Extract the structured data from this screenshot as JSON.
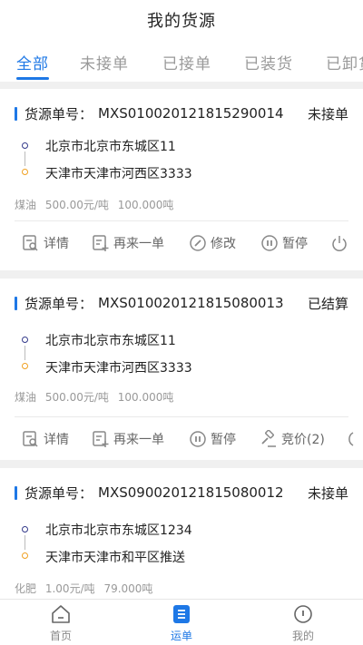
{
  "header": {
    "title": "我的货源"
  },
  "tabs": [
    {
      "label": "全部",
      "active": true
    },
    {
      "label": "未接单",
      "active": false
    },
    {
      "label": "已接单",
      "active": false
    },
    {
      "label": "已装货",
      "active": false
    },
    {
      "label": "已卸货",
      "active": false
    }
  ],
  "cards": [
    {
      "order_label": "货源单号：",
      "order_no": "MXS010020121815290014",
      "status": "未接单",
      "from": "北京市北京市东城区11",
      "to": "天津市天津市河西区3333",
      "goods_name": "煤油",
      "price": "500.00元/吨",
      "weight": "100.000吨",
      "actions": [
        "详情",
        "再来一单",
        "修改",
        "暂停"
      ]
    },
    {
      "order_label": "货源单号：",
      "order_no": "MXS010020121815080013",
      "status": "已结算",
      "from": "北京市北京市东城区11",
      "to": "天津市天津市河西区3333",
      "goods_name": "煤油",
      "price": "500.00元/吨",
      "weight": "100.000吨",
      "actions": [
        "详情",
        "再来一单",
        "暂停",
        "竞价(2)"
      ]
    },
    {
      "order_label": "货源单号：",
      "order_no": "MXS090020121815080012",
      "status": "未接单",
      "from": "北京市北京市东城区1234",
      "to": "天津市天津市和平区推送",
      "goods_name": "化肥",
      "price": "1.00元/吨",
      "weight": "79.000吨",
      "actions": []
    }
  ],
  "bottom_nav": [
    {
      "label": "首页",
      "icon": "home-icon",
      "active": false
    },
    {
      "label": "运单",
      "icon": "waybill-icon",
      "active": true
    },
    {
      "label": "我的",
      "icon": "profile-icon",
      "active": false
    }
  ],
  "colors": {
    "accent": "#1e78e6",
    "from_dot": "#333a8a",
    "to_dot": "#f0a020"
  }
}
